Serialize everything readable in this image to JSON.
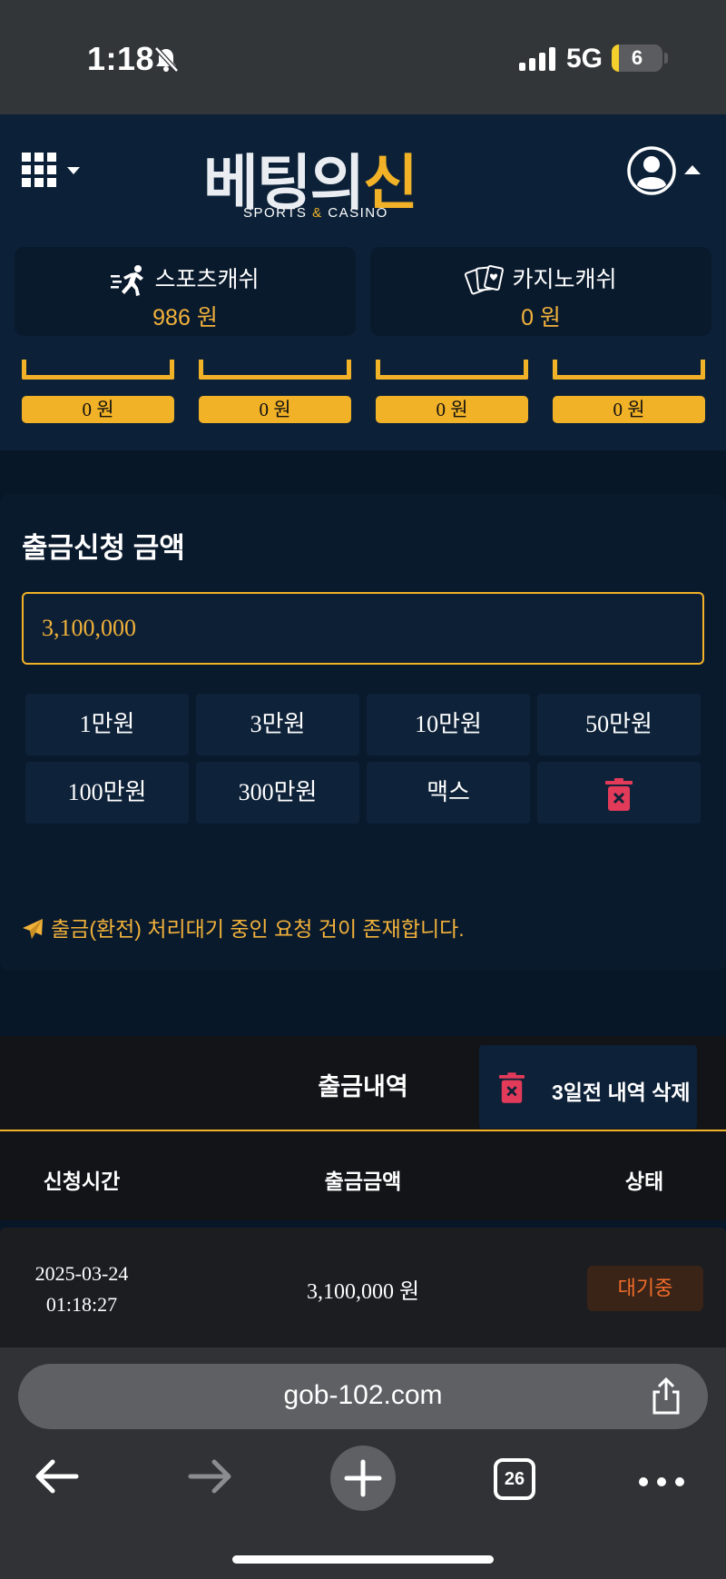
{
  "status_bar": {
    "time": "1:18",
    "network": "5G",
    "battery": "6"
  },
  "header": {
    "logo_main": "베팅의",
    "logo_accent": "신",
    "logo_sub_left": "SPORTS",
    "logo_sub_amp": "&",
    "logo_sub_right": "CASINO"
  },
  "wallets": [
    {
      "label": "스포츠캐쉬",
      "amount": "986 원"
    },
    {
      "label": "카지노캐쉬",
      "amount": "0 원"
    }
  ],
  "balances": [
    "0 원",
    "0 원",
    "0 원",
    "0 원"
  ],
  "withdraw": {
    "title": "출금신청 금액",
    "amount_value": "3,100,000",
    "quick_amounts": [
      "1만원",
      "3만원",
      "10만원",
      "50만원",
      "100만원",
      "300만원",
      "맥스"
    ],
    "notice": "출금(환전) 처리대기 중인 요청 건이 존재합니다."
  },
  "history": {
    "title": "출금내역",
    "delete_label": "3일전 내역 삭제",
    "columns": [
      "신청시간",
      "출금금액",
      "상태"
    ],
    "rows": [
      {
        "date": "2025-03-24",
        "time": "01:18:27",
        "amount": "3,100,000 원",
        "status": "대기중"
      }
    ]
  },
  "browser": {
    "url": "gob-102.com",
    "tab_count": "26"
  },
  "colors": {
    "accent": "#f2b227",
    "background": "#081727",
    "panel": "#0a1a2d",
    "pending": "#f06c2a"
  }
}
